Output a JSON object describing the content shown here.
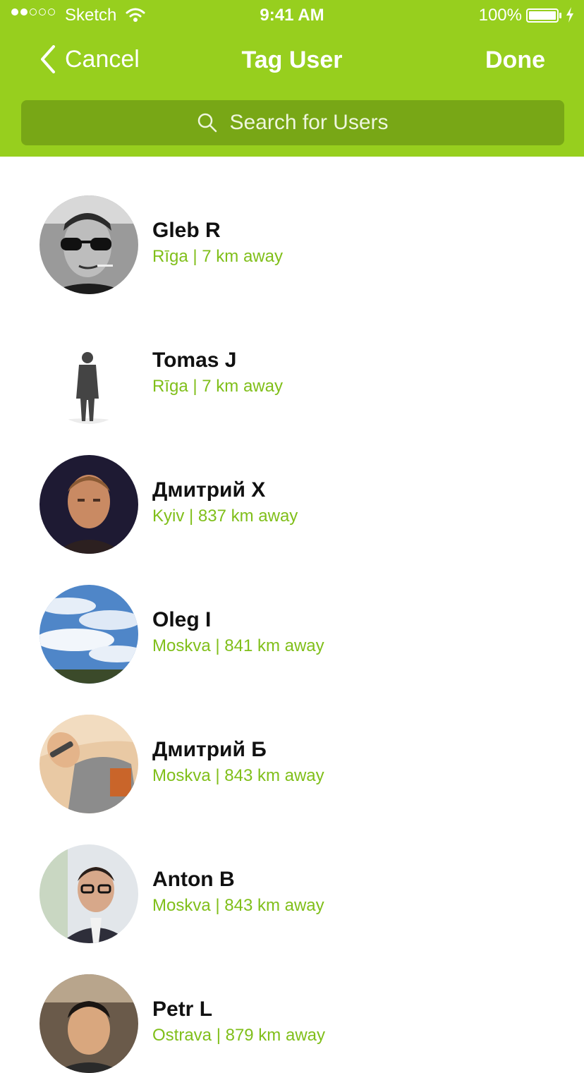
{
  "status_bar": {
    "carrier": "Sketch",
    "time": "9:41 AM",
    "battery": "100%"
  },
  "nav": {
    "cancel_label": "Cancel",
    "title": "Tag User",
    "done_label": "Done"
  },
  "search": {
    "placeholder": "Search for Users"
  },
  "colors": {
    "brand_green": "#97cf1e",
    "search_bg": "#78a716",
    "location_green": "#80bf1a"
  },
  "users": [
    {
      "name": "Gleb R",
      "location": "Rīga | 7 km away"
    },
    {
      "name": "Tomas J",
      "location": "Rīga | 7 km away"
    },
    {
      "name": "Дмитрий Х",
      "location": "Kyiv | 837 km away"
    },
    {
      "name": "Oleg I",
      "location": "Moskva | 841 km away"
    },
    {
      "name": "Дмитрий Б",
      "location": "Moskva | 843 km away"
    },
    {
      "name": "Anton B",
      "location": "Moskva | 843 km away"
    },
    {
      "name": "Petr L",
      "location": "Ostrava | 879 km away"
    }
  ]
}
